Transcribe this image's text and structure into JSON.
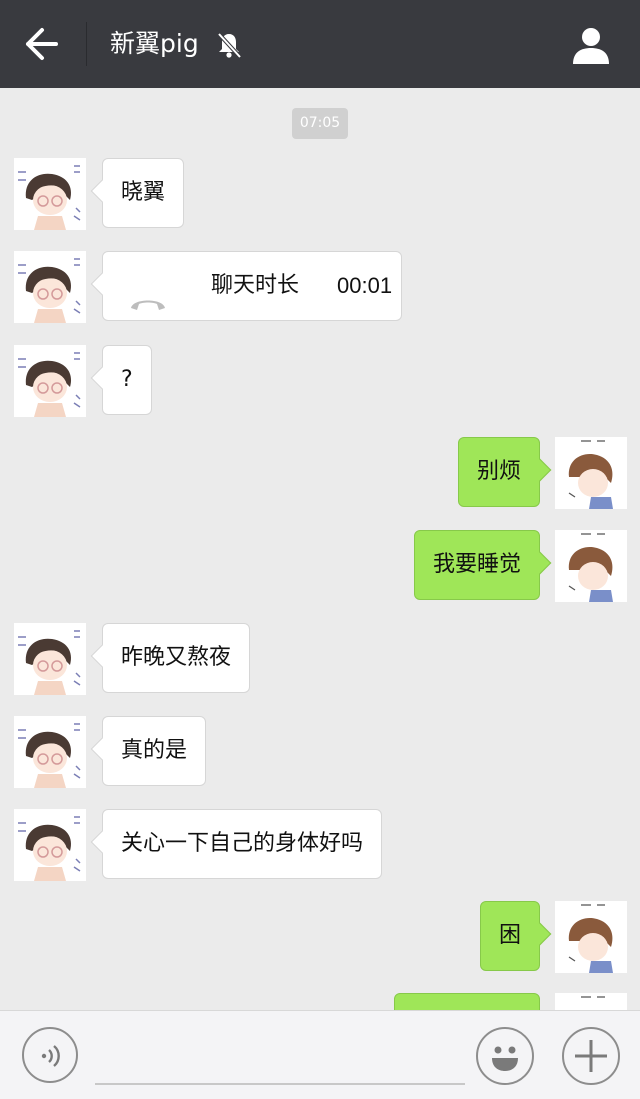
{
  "header": {
    "title": "新翼pig",
    "back_icon": "arrow-left-icon",
    "mute_icon": "bell-muted-icon",
    "profile_icon": "person-icon"
  },
  "chat": {
    "timestamp": "07:05",
    "messages": [
      {
        "side": "left",
        "type": "text",
        "text": "晓翼"
      },
      {
        "side": "left",
        "type": "call",
        "label": "聊天时长",
        "duration": "00:01"
      },
      {
        "side": "left",
        "type": "text",
        "text": "?"
      },
      {
        "side": "right",
        "type": "text",
        "text": "别烦"
      },
      {
        "side": "right",
        "type": "text",
        "text": "我要睡觉"
      },
      {
        "side": "left",
        "type": "text",
        "text": "昨晚又熬夜"
      },
      {
        "side": "left",
        "type": "text",
        "text": "真的是"
      },
      {
        "side": "left",
        "type": "text",
        "text": "关心一下自己的身体好吗"
      },
      {
        "side": "right",
        "type": "text",
        "text": "困"
      },
      {
        "side": "right",
        "type": "text",
        "text": ""
      }
    ]
  },
  "input_bar": {
    "voice_icon": "voice-icon",
    "input_value": "",
    "emoji_icon": "smiley-icon",
    "plus_icon": "plus-icon"
  },
  "colors": {
    "topbar": "#393a3f",
    "chat_background": "#ebebeb",
    "sent_bubble": "#9fe658",
    "received_bubble": "#ffffff"
  }
}
